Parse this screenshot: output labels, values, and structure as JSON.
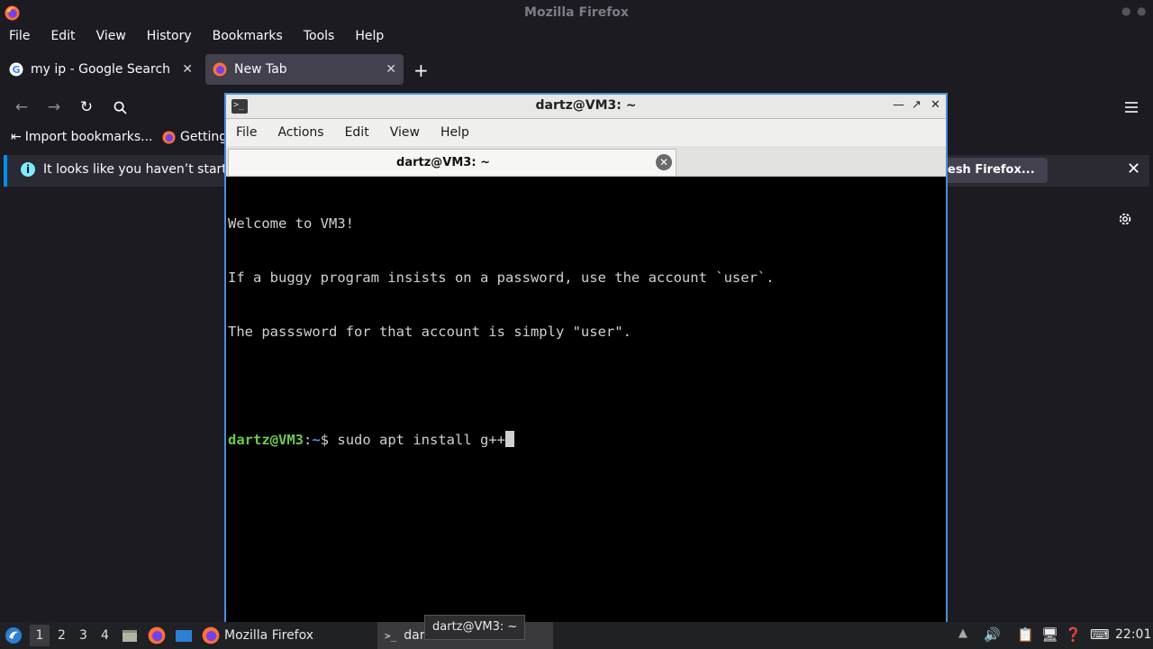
{
  "firefox": {
    "window_title": "Mozilla Firefox",
    "menu": [
      "File",
      "Edit",
      "View",
      "History",
      "Bookmarks",
      "Tools",
      "Help"
    ],
    "tabs": [
      {
        "label": "my ip - Google Search",
        "icon": "google-icon",
        "active": false
      },
      {
        "label": "New Tab",
        "icon": "firefox-icon",
        "active": true
      }
    ],
    "bookmarks": [
      {
        "label": "Import bookmarks...",
        "icon": "import-icon"
      },
      {
        "label": "Getting",
        "icon": "firefox-icon"
      }
    ],
    "notice": {
      "text": "It looks like you haven’t started",
      "button": "esh Firefox..."
    }
  },
  "terminal": {
    "title": "dartz@VM3: ~",
    "menu": [
      "File",
      "Actions",
      "Edit",
      "View",
      "Help"
    ],
    "tab_label": "dartz@VM3: ~",
    "lines": [
      "Welcome to VM3!",
      "If a buggy program insists on a password, use the account `user`.",
      "The passsword for that account is simply \"user\".",
      ""
    ],
    "prompt": {
      "user_host": "dartz@VM3",
      "sep": ":",
      "path": "~",
      "symbol": "$ ",
      "command": "sudo apt install g++"
    }
  },
  "taskbar": {
    "workspaces": [
      "1",
      "2",
      "3",
      "4"
    ],
    "tasks": [
      {
        "label": "Mozilla Firefox",
        "icon": "firefox-icon"
      },
      {
        "label": "dar",
        "icon": "terminal-icon"
      }
    ],
    "tooltip": "dartz@VM3: ~",
    "clock": "22:01"
  },
  "colors": {
    "accent": "#0090ed",
    "terminal_border": "#4a90d9",
    "prompt_user": "#6ec94a",
    "prompt_path": "#5c8ee6"
  }
}
